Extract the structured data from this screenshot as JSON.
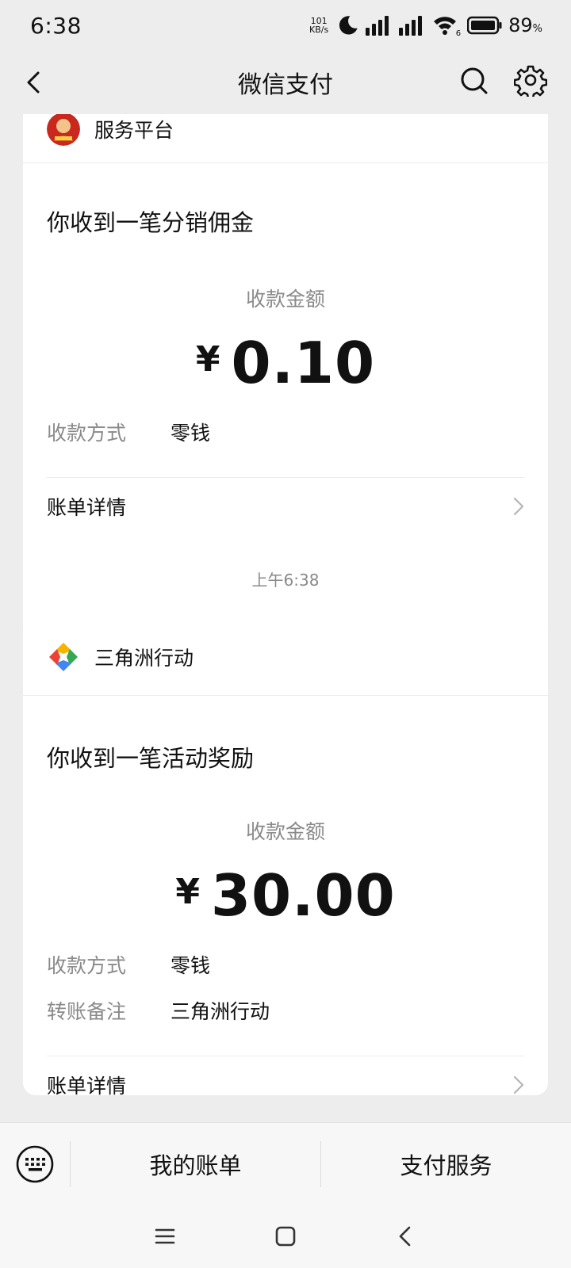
{
  "status_bar": {
    "time": "6:38",
    "net_speed_value": "101",
    "net_speed_unit": "KB/s",
    "signal_sub": "6",
    "battery_percent": "89",
    "battery_unit": "%"
  },
  "nav": {
    "title": "微信支付",
    "back_icon": "chevron-left-icon",
    "search_icon": "search-icon",
    "settings_icon": "gear-icon"
  },
  "messages": [
    {
      "sender": "服务平台",
      "title": "你收到一笔分销佣金",
      "amount_label": "收款金额",
      "currency": "¥",
      "amount": "0.10",
      "rows": [
        {
          "key": "收款方式",
          "value": "零钱"
        }
      ],
      "detail_label": "账单详情"
    },
    {
      "timestamp": "上午6:38",
      "sender": "三角洲行动",
      "title": "你收到一笔活动奖励",
      "amount_label": "收款金额",
      "currency": "¥",
      "amount": "30.00",
      "rows": [
        {
          "key": "收款方式",
          "value": "零钱"
        },
        {
          "key": "转账备注",
          "value": "三角洲行动"
        }
      ],
      "detail_label": "账单详情"
    }
  ],
  "bottom_bar": {
    "keyboard_icon": "keyboard-icon",
    "tab_1": "我的账单",
    "tab_2": "支付服务"
  },
  "colors": {
    "background": "#ededed",
    "card": "#ffffff",
    "muted_text": "#8a8a8a"
  }
}
